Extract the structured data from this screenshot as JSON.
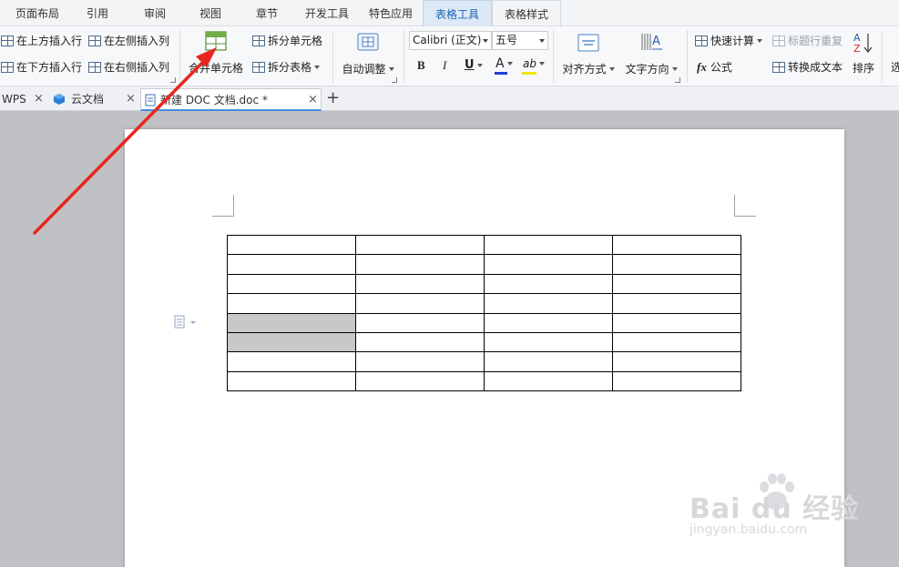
{
  "menu": {
    "tabs": [
      {
        "label": "页面布局"
      },
      {
        "label": "引用"
      },
      {
        "label": "审阅"
      },
      {
        "label": "视图"
      },
      {
        "label": "章节"
      },
      {
        "label": "开发工具"
      },
      {
        "label": "特色应用"
      },
      {
        "label": "表格工具",
        "active": true
      },
      {
        "label": "表格样式"
      }
    ]
  },
  "ribbon": {
    "insert_row_above": "在上方插入行",
    "insert_row_below": "在下方插入行",
    "insert_col_left": "在左侧插入列",
    "insert_col_right": "在右侧插入列",
    "merge_cells": "合并单元格",
    "split_cells": "拆分单元格",
    "split_table": "拆分表格",
    "auto_fit": "自动调整",
    "font_name": "Calibri (正文)",
    "font_size": "五号",
    "bold": "B",
    "italic": "I",
    "underline": "U",
    "font_color_glyph": "A",
    "highlight_glyph": "ab",
    "align": "对齐方式",
    "text_direction": "文字方向",
    "quick_calc": "快速计算",
    "repeat_header": "标题行重复",
    "formula": "公式",
    "formula_glyph": "fx",
    "convert_to_text": "转换成文本",
    "sort": "排序",
    "more": "选"
  },
  "doc_tabs": [
    {
      "label": "WPS"
    },
    {
      "label": "云文档"
    },
    {
      "label": "新建 DOC 文档.doc *",
      "active": true
    }
  ],
  "new_tab_glyph": "+",
  "close_glyph": "×",
  "document": {
    "table": {
      "rows": 8,
      "cols": 4,
      "selected_cells": [
        [
          4,
          0
        ],
        [
          5,
          0
        ]
      ]
    }
  },
  "watermark": {
    "brand": "Bai du 经验",
    "url": "jingyan.baidu.com"
  },
  "colors": {
    "active_tab_text": "#1a63b5",
    "arrow": "#e8261d",
    "font_color_bar": "#1f3fd6",
    "highlight_bar": "#f5e70a"
  }
}
